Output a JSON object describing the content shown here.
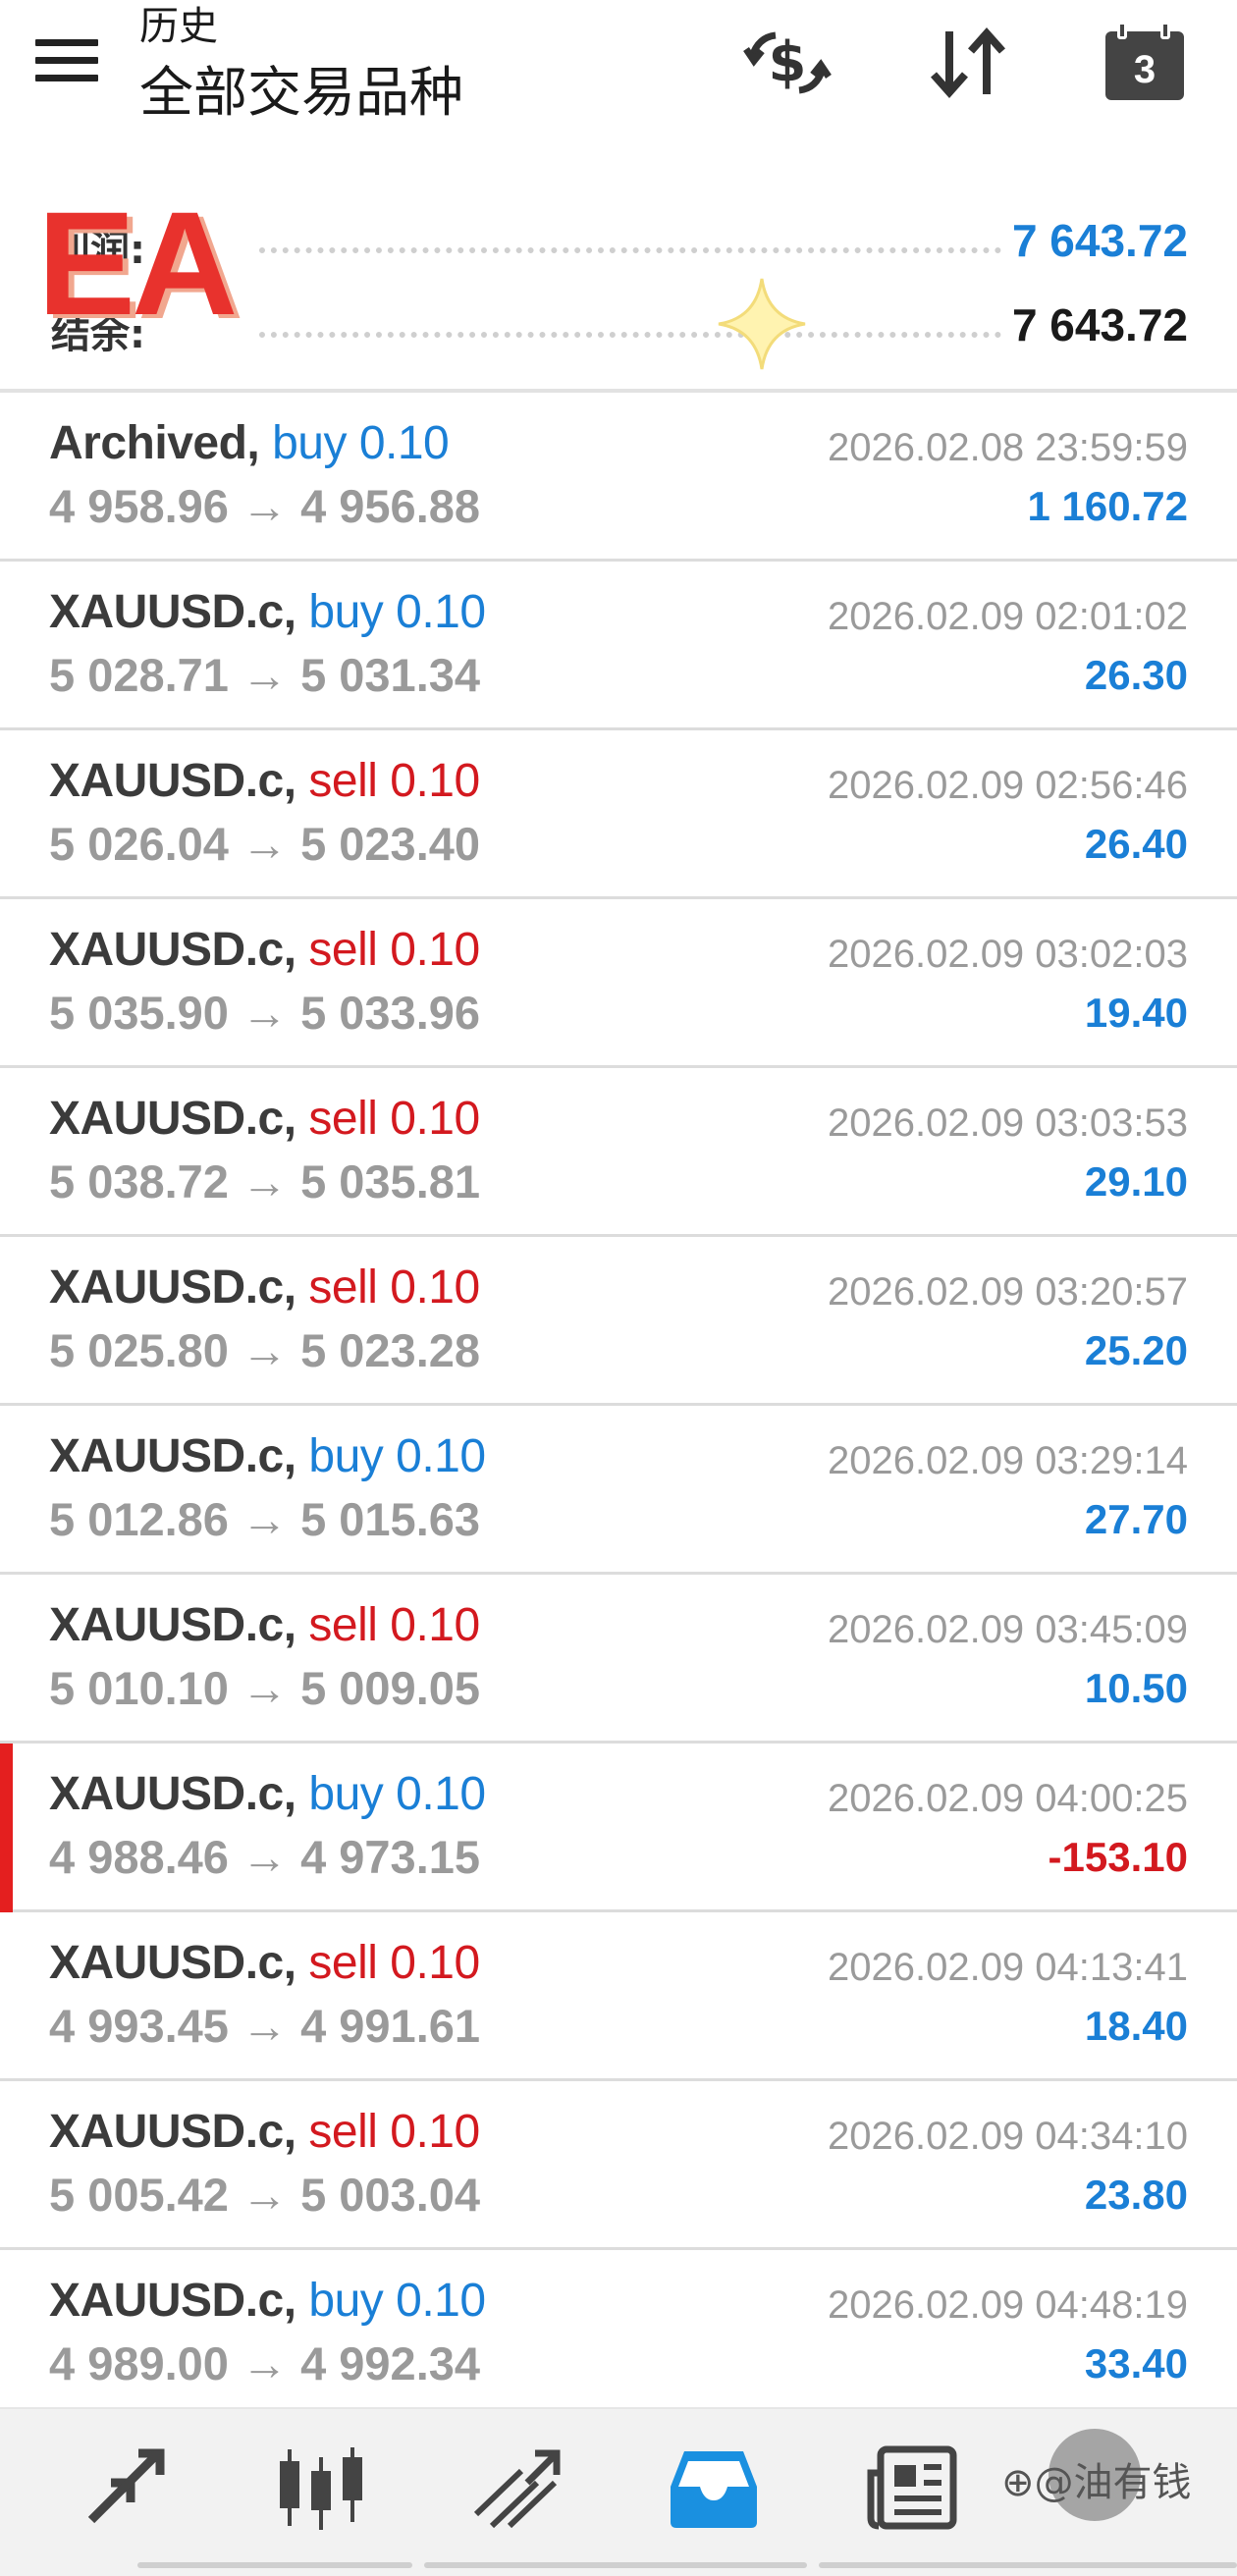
{
  "header": {
    "title_small": "历史",
    "title_large": "全部交易品种",
    "icons": [
      "menu-icon",
      "currency-exchange-icon",
      "sort-arrows-icon",
      "calendar-icon"
    ],
    "calendar_day": "3"
  },
  "summary": {
    "profit_label": "利润:",
    "profit_value": "7 643.72",
    "balance_label": "结余:",
    "balance_value": "7 643.72",
    "overlay_logo": "EA"
  },
  "colors": {
    "buy": "#1a7fd6",
    "sell": "#d3191f",
    "profit_positive": "#1a7fd6",
    "profit_negative": "#d3191f",
    "flag": "#e41f1f"
  },
  "trades": [
    {
      "symbol": "Archived,",
      "side": "buy 0.10",
      "type": "buy",
      "open": "4 958.96",
      "arrow": "→",
      "close": "4 956.88",
      "time": "2026.02.08 23:59:59",
      "profit": "1 160.72",
      "negative": false
    },
    {
      "symbol": "XAUUSD.c,",
      "side": "buy 0.10",
      "type": "buy",
      "open": "5 028.71",
      "arrow": "→",
      "close": "5 031.34",
      "time": "2026.02.09 02:01:02",
      "profit": "26.30",
      "negative": false
    },
    {
      "symbol": "XAUUSD.c,",
      "side": "sell 0.10",
      "type": "sell",
      "open": "5 026.04",
      "arrow": "→",
      "close": "5 023.40",
      "time": "2026.02.09 02:56:46",
      "profit": "26.40",
      "negative": false
    },
    {
      "symbol": "XAUUSD.c,",
      "side": "sell 0.10",
      "type": "sell",
      "open": "5 035.90",
      "arrow": "→",
      "close": "5 033.96",
      "time": "2026.02.09 03:02:03",
      "profit": "19.40",
      "negative": false
    },
    {
      "symbol": "XAUUSD.c,",
      "side": "sell 0.10",
      "type": "sell",
      "open": "5 038.72",
      "arrow": "→",
      "close": "5 035.81",
      "time": "2026.02.09 03:03:53",
      "profit": "29.10",
      "negative": false
    },
    {
      "symbol": "XAUUSD.c,",
      "side": "sell 0.10",
      "type": "sell",
      "open": "5 025.80",
      "arrow": "→",
      "close": "5 023.28",
      "time": "2026.02.09 03:20:57",
      "profit": "25.20",
      "negative": false
    },
    {
      "symbol": "XAUUSD.c,",
      "side": "buy 0.10",
      "type": "buy",
      "open": "5 012.86",
      "arrow": "→",
      "close": "5 015.63",
      "time": "2026.02.09 03:29:14",
      "profit": "27.70",
      "negative": false
    },
    {
      "symbol": "XAUUSD.c,",
      "side": "sell 0.10",
      "type": "sell",
      "open": "5 010.10",
      "arrow": "→",
      "close": "5 009.05",
      "time": "2026.02.09 03:45:09",
      "profit": "10.50",
      "negative": false
    },
    {
      "symbol": "XAUUSD.c,",
      "side": "buy 0.10",
      "type": "buy",
      "open": "4 988.46",
      "arrow": "→",
      "close": "4 973.15",
      "time": "2026.02.09 04:00:25",
      "profit": "-153.10",
      "negative": true
    },
    {
      "symbol": "XAUUSD.c,",
      "side": "sell 0.10",
      "type": "sell",
      "open": "4 993.45",
      "arrow": "→",
      "close": "4 991.61",
      "time": "2026.02.09 04:13:41",
      "profit": "18.40",
      "negative": false
    },
    {
      "symbol": "XAUUSD.c,",
      "side": "sell 0.10",
      "type": "sell",
      "open": "5 005.42",
      "arrow": "→",
      "close": "5 003.04",
      "time": "2026.02.09 04:34:10",
      "profit": "23.80",
      "negative": false
    },
    {
      "symbol": "XAUUSD.c,",
      "side": "buy 0.10",
      "type": "buy",
      "open": "4 989.00",
      "arrow": "→",
      "close": "4 992.34",
      "time": "2026.02.09 04:48:19",
      "profit": "33.40",
      "negative": false
    }
  ],
  "bottom_nav": {
    "items": [
      {
        "icon": "quotes-arrows-icon",
        "active": false
      },
      {
        "icon": "candlestick-chart-icon",
        "active": false
      },
      {
        "icon": "trend-lines-icon",
        "active": false
      },
      {
        "icon": "history-inbox-icon",
        "active": true
      },
      {
        "icon": "news-icon",
        "active": false
      }
    ],
    "watermark": "⊕@油有钱"
  }
}
